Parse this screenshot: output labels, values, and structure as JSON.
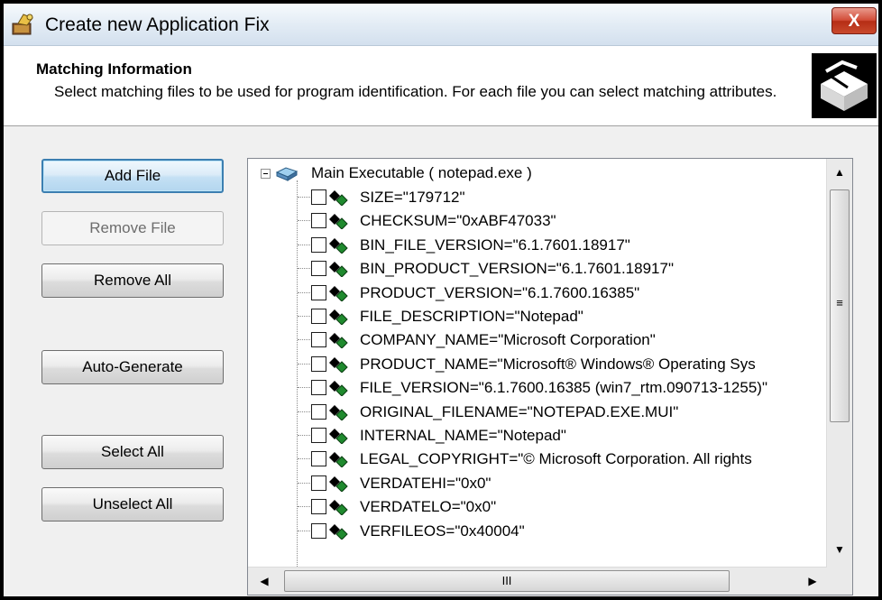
{
  "window": {
    "title": "Create new Application Fix",
    "close_label": "X"
  },
  "header": {
    "title": "Matching Information",
    "description": "Select matching files to be used for program identification. For each file you can select matching attributes."
  },
  "buttons": {
    "add_file": "Add File",
    "remove_file": "Remove File",
    "remove_all": "Remove All",
    "auto_generate": "Auto-Generate",
    "select_all": "Select All",
    "unselect_all": "Unselect All"
  },
  "tree": {
    "root_label": "Main Executable ( notepad.exe )",
    "items": [
      {
        "label": "SIZE=\"179712\"",
        "checked": false
      },
      {
        "label": "CHECKSUM=\"0xABF47033\"",
        "checked": false
      },
      {
        "label": "BIN_FILE_VERSION=\"6.1.7601.18917\"",
        "checked": false
      },
      {
        "label": "BIN_PRODUCT_VERSION=\"6.1.7601.18917\"",
        "checked": false
      },
      {
        "label": "PRODUCT_VERSION=\"6.1.7600.16385\"",
        "checked": false
      },
      {
        "label": "FILE_DESCRIPTION=\"Notepad\"",
        "checked": false
      },
      {
        "label": "COMPANY_NAME=\"Microsoft Corporation\"",
        "checked": false
      },
      {
        "label": "PRODUCT_NAME=\"Microsoft® Windows® Operating Sys",
        "checked": false
      },
      {
        "label": "FILE_VERSION=\"6.1.7600.16385 (win7_rtm.090713-1255)\"",
        "checked": false
      },
      {
        "label": "ORIGINAL_FILENAME=\"NOTEPAD.EXE.MUI\"",
        "checked": false
      },
      {
        "label": "INTERNAL_NAME=\"Notepad\"",
        "checked": false
      },
      {
        "label": "LEGAL_COPYRIGHT=\"© Microsoft Corporation. All rights",
        "checked": false
      },
      {
        "label": "VERDATEHI=\"0x0\"",
        "checked": false
      },
      {
        "label": "VERDATELO=\"0x0\"",
        "checked": false
      },
      {
        "label": "VERFILEOS=\"0x40004\"",
        "checked": false
      }
    ]
  },
  "scrollbars": {
    "up": "▲",
    "down": "▼",
    "left": "◀",
    "right": "▶",
    "v_grip": "≡",
    "h_grip": "III"
  },
  "colors": {
    "close_button": "#c9442a",
    "default_button_border": "#3c7fb1",
    "tree_icon_black": "#000000",
    "tree_icon_green": "#1f8a2e"
  }
}
